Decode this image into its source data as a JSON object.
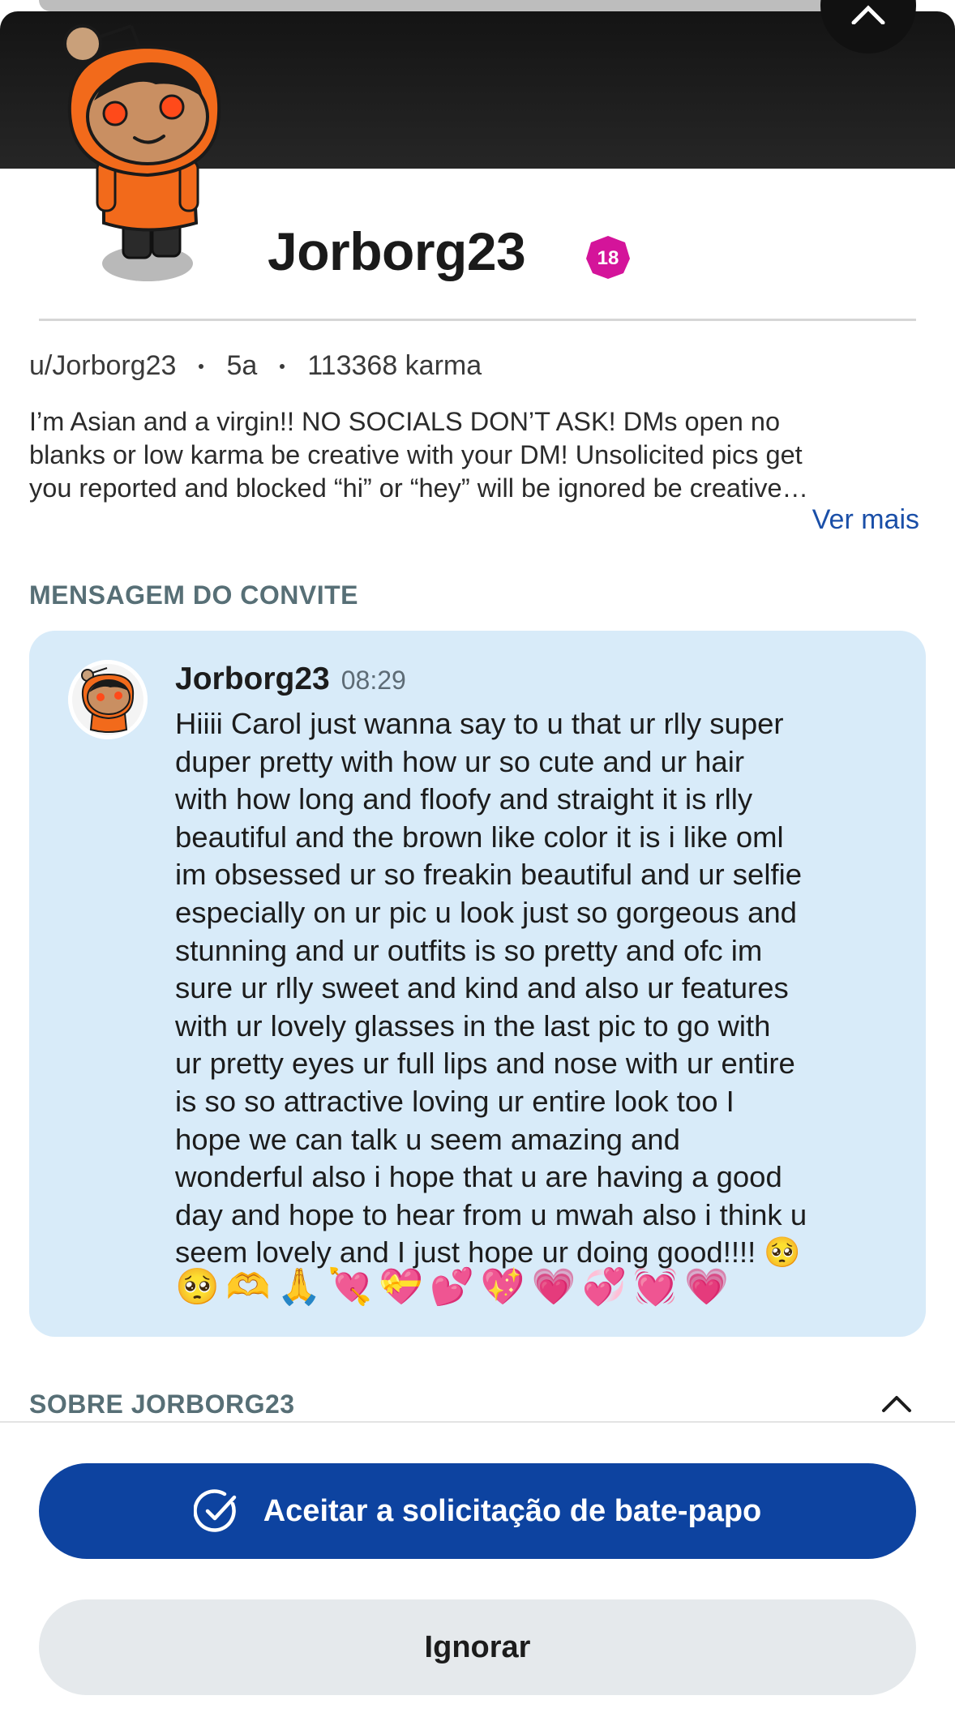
{
  "profile": {
    "username": "Jorborg23",
    "nsfw_badge": "18",
    "handle": "u/Jorborg23",
    "account_age": "5a",
    "karma": "113368 karma",
    "bio_lines": [
      "I’m Asian and a virgin!! NO SOCIALS DON’T ASK! DMs open no",
      "blanks or low karma be creative with your DM! Unsolicited pics get",
      "you reported and blocked “hi” or “hey” will be ignored be creative…"
    ],
    "see_more": "Ver mais"
  },
  "invite": {
    "section_label": "MENSAGEM DO CONVITE",
    "author": "Jorborg23",
    "time": "08:29",
    "body_lines": [
      "Hiiii Carol just wanna say to u that ur rlly super",
      "duper pretty with how ur so cute and ur hair",
      "with how long and floofy and straight it is rlly",
      "beautiful and the brown like color it is i like oml",
      "im obsessed ur so freakin beautiful and ur selfie",
      "especially on ur pic u look just so gorgeous and",
      "stunning and ur outfits is so pretty and ofc im",
      "sure ur rlly sweet and kind and also ur features",
      "with ur lovely glasses in the last pic to go with",
      "ur pretty eyes ur full lips and nose with ur entire",
      "is so so attractive loving ur entire look too I",
      "hope we can talk u seem amazing and",
      "wonderful also i hope that u are having a good",
      "day and hope to hear from u mwah also i think u",
      "seem lovely and I just hope ur doing good!!!! 🥺"
    ],
    "emojis": [
      "🥺",
      "🫶",
      "🙏",
      "💘",
      "💝",
      "💕",
      "💖",
      "💗",
      "💞",
      "💓",
      "💗"
    ]
  },
  "about": {
    "section_label": "SOBRE JORBORG23"
  },
  "actions": {
    "accept_label": "Aceitar a solicitação de bate-papo",
    "ignore_label": "Ignorar"
  },
  "colors": {
    "accept_bg": "#0d43a0",
    "card_bg": "#d8ebf9",
    "nsfw": "#d4149a",
    "link": "#1a4fa8"
  },
  "icons": {
    "close": "close-icon",
    "accept": "check-circle-icon",
    "collapse": "chevron-up-icon"
  }
}
